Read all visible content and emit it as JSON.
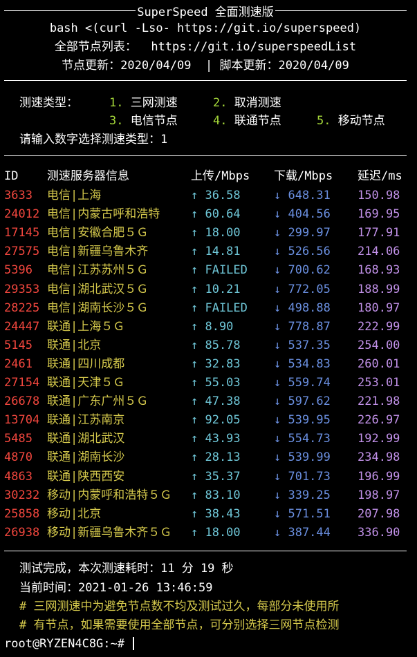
{
  "header": {
    "title": "SuperSpeed 全面测速版",
    "command": "bash <(curl -Lso- https://git.io/superspeed)",
    "node_list_label": "全部节点列表：",
    "node_list_url": "https://git.io/superspeedList",
    "update_line": "节点更新：2020/04/09  | 脚本更新：2020/04/09"
  },
  "menu": {
    "type_label": "测速类型：",
    "options": [
      {
        "num": "1.",
        "label": "三网测速"
      },
      {
        "num": "2.",
        "label": "取消测速"
      },
      {
        "num": "3.",
        "label": "电信节点"
      },
      {
        "num": "4.",
        "label": "联通节点"
      },
      {
        "num": "5.",
        "label": "移动节点"
      }
    ],
    "prompt": "请输入数字选择测速类型：",
    "input_value": "1"
  },
  "table": {
    "headers": {
      "id": "ID",
      "name": "测速服务器信息",
      "up": "上传/Mbps",
      "down": "下载/Mbps",
      "latency": "延迟/ms"
    },
    "rows": [
      {
        "id": "3633",
        "name": "电信|上海",
        "up": "↑ 36.58",
        "down": "↓ 648.31",
        "latency": "150.98"
      },
      {
        "id": "24012",
        "name": "电信|内蒙古呼和浩特",
        "up": "↑ 60.64",
        "down": "↓ 404.56",
        "latency": "169.95"
      },
      {
        "id": "17145",
        "name": "电信|安徽合肥５Ｇ",
        "up": "↑ 18.00",
        "down": "↓ 299.97",
        "latency": "177.91"
      },
      {
        "id": "27575",
        "name": "电信|新疆乌鲁木齐",
        "up": "↑ 14.81",
        "down": "↓ 526.56",
        "latency": "214.06"
      },
      {
        "id": "5396",
        "name": "电信|江苏苏州５Ｇ",
        "up": "↑ FAILED",
        "down": "↓ 700.62",
        "latency": "168.93"
      },
      {
        "id": "29353",
        "name": "电信|湖北武汉５Ｇ",
        "up": "↑ 10.21",
        "down": "↓ 772.05",
        "latency": "188.99"
      },
      {
        "id": "28225",
        "name": "电信|湖南长沙５Ｇ",
        "up": "↑ FAILED",
        "down": "↓ 498.88",
        "latency": "180.97"
      },
      {
        "id": "24447",
        "name": "联通|上海５Ｇ",
        "up": "↑ 8.90",
        "down": "↓ 778.87",
        "latency": "222.99"
      },
      {
        "id": "5145",
        "name": "联通|北京",
        "up": "↑ 85.78",
        "down": "↓ 537.35",
        "latency": "254.00"
      },
      {
        "id": "2461",
        "name": "联通|四川成都",
        "up": "↑ 32.83",
        "down": "↓ 534.83",
        "latency": "260.01"
      },
      {
        "id": "27154",
        "name": "联通|天津５Ｇ",
        "up": "↑ 55.03",
        "down": "↓ 559.74",
        "latency": "253.01"
      },
      {
        "id": "26678",
        "name": "联通|广东广州５Ｇ",
        "up": "↑ 47.38",
        "down": "↓ 597.62",
        "latency": "221.98"
      },
      {
        "id": "13704",
        "name": "联通|江苏南京",
        "up": "↑ 92.05",
        "down": "↓ 539.95",
        "latency": "226.97"
      },
      {
        "id": "5485",
        "name": "联通|湖北武汉",
        "up": "↑ 43.93",
        "down": "↓ 554.73",
        "latency": "192.99"
      },
      {
        "id": "4870",
        "name": "联通|湖南长沙",
        "up": "↑ 28.13",
        "down": "↓ 539.99",
        "latency": "234.98"
      },
      {
        "id": "4863",
        "name": "联通|陕西西安",
        "up": "↑ 35.37",
        "down": "↓ 701.73",
        "latency": "196.99"
      },
      {
        "id": "30232",
        "name": "移动|内蒙呼和浩特５Ｇ",
        "up": "↑ 83.10",
        "down": "↓ 339.25",
        "latency": "198.97"
      },
      {
        "id": "25858",
        "name": "移动|北京",
        "up": "↑ 38.43",
        "down": "↓ 571.51",
        "latency": "207.98"
      },
      {
        "id": "26938",
        "name": "移动|新疆乌鲁木齐５Ｇ",
        "up": "↑ 18.00",
        "down": "↓ 387.44",
        "latency": "336.90"
      }
    ]
  },
  "summary": {
    "done_line": "测试完成，本次测速耗时：11 分 19 秒",
    "time_line": "当前时间：2021-01-26 13:46:59",
    "note_line1": "# 三网测速中为避免节点数不均及测试过久，每部分未使用所",
    "note_line2": "# 有节点，如果需要使用全部节点，可分别选择三网节点检测"
  },
  "prompt": {
    "text": "root@RYZEN4C8G:~# "
  },
  "colors": {
    "background": "#000000",
    "menu_option": "#a6d93a",
    "id": "#f3473e",
    "name": "#d5c94c",
    "upload": "#6fc7d8",
    "download": "#6a8fe0",
    "latency": "#c191e8",
    "comment": "#d5c94c"
  }
}
